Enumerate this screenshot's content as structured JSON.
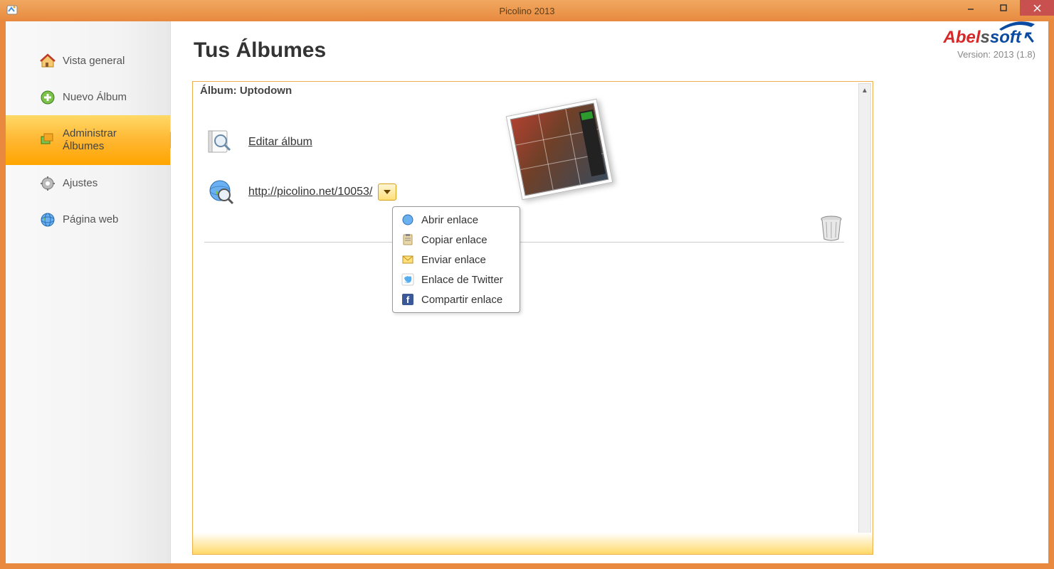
{
  "window": {
    "title": "Picolino 2013"
  },
  "brand": {
    "name": "Abelssoft",
    "version_label": "Version: 2013 (1.8)"
  },
  "sidebar": {
    "items": [
      {
        "label": "Vista general",
        "icon": "home-icon"
      },
      {
        "label": "Nuevo Álbum",
        "icon": "plus-icon"
      },
      {
        "label": "Administrar Álbumes",
        "icon": "albums-icon",
        "active": true
      },
      {
        "label": "Ajustes",
        "icon": "gear-icon"
      },
      {
        "label": "Página web",
        "icon": "globe-icon"
      }
    ]
  },
  "main": {
    "title": "Tus Álbumes",
    "album": {
      "header_label": "Álbum: Uptodown",
      "edit_label": "Editar álbum",
      "url": "http://picolino.net/10053/"
    },
    "dropdown_menu": [
      {
        "label": "Abrir enlace",
        "icon": "globe-icon"
      },
      {
        "label": "Copiar enlace",
        "icon": "clipboard-icon"
      },
      {
        "label": "Enviar enlace",
        "icon": "mail-icon"
      },
      {
        "label": "Enlace de Twitter",
        "icon": "twitter-icon"
      },
      {
        "label": "Compartir enlace",
        "icon": "facebook-icon"
      }
    ]
  }
}
